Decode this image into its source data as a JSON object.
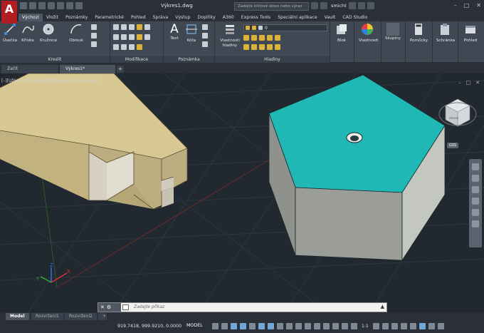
{
  "app": {
    "logo": "A",
    "title": "Výkres1.dwg"
  },
  "search": {
    "placeholder": "Zadejte klíčové slovo nebo výraz"
  },
  "user": {
    "name": "smicht"
  },
  "ribbon_tabs": [
    "Výchozí",
    "Vložit",
    "Poznámky",
    "Parametrické",
    "Pohled",
    "Správa",
    "Výstup",
    "Doplňky",
    "A360",
    "Express Tools",
    "Speciální aplikace",
    "Vault",
    "CAD Studio"
  ],
  "ribbon": {
    "draw": {
      "label": "Kreslit",
      "line": "Úsečka",
      "polyline": "Křivka",
      "circle": "Kružnice",
      "arc": "Oblouk"
    },
    "modify": {
      "label": "Modifikace"
    },
    "annotation": {
      "label": "Poznámka",
      "text": "Text",
      "dimension": "Kóta"
    },
    "layers": {
      "label": "Hladiny",
      "properties": "Vlastnosti hladiny",
      "current_layer": "0"
    },
    "block": {
      "label": "Blok"
    },
    "properties": {
      "label": "Vlastnosti"
    },
    "groups": {
      "label": "Skupiny"
    },
    "utilities": {
      "label": "Pomůcky"
    },
    "clipboard": {
      "label": "Schránka"
    },
    "view": {
      "label": "Pohled"
    }
  },
  "file_tabs": {
    "start": "Začít",
    "drawing": "Výkres1*"
  },
  "viewport": {
    "label": "[–][Uživatelský pohled][Stínovaný s hranami]",
    "viewcube_face": "PŘEDNÍ",
    "wcs": "GSS"
  },
  "command": {
    "placeholder": "Zadejte příkaz"
  },
  "layout_tabs": [
    "Model",
    "Rozvržení1",
    "Rozvržení2"
  ],
  "status": {
    "coords": "919.7418, 999.9210, 0.0000",
    "model": "MODEL",
    "scale": "1:1"
  },
  "colors": {
    "accent": "#b01e23",
    "hex_top": "#1fb8b4",
    "beam": "#c8b884",
    "background": "#212830"
  }
}
